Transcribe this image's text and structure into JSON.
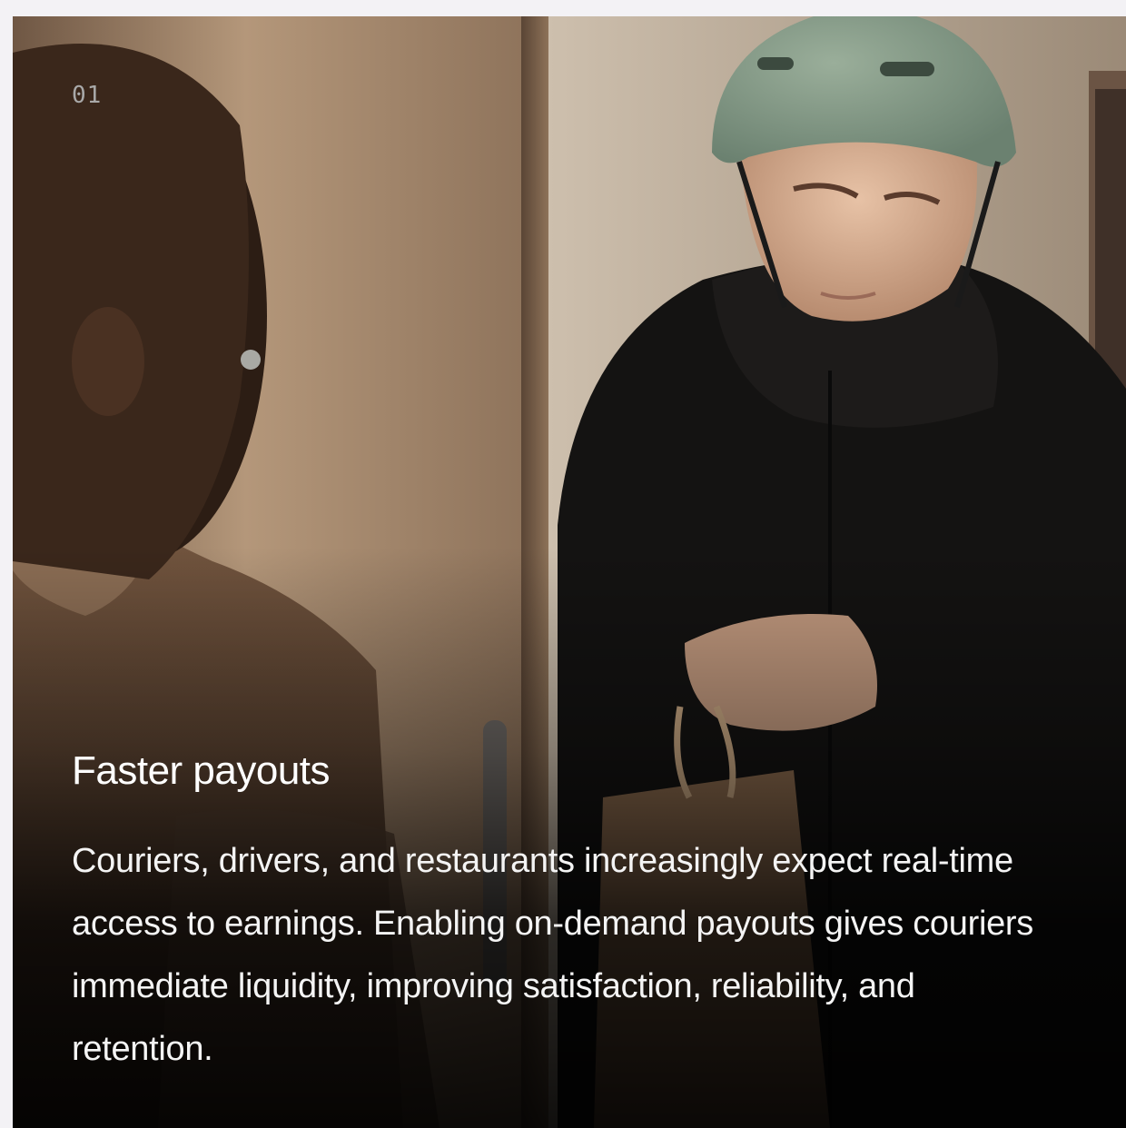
{
  "card": {
    "index": "01",
    "title": "Faster payouts",
    "description": "Couriers, drivers, and restaurants increasingly expect real-time access to earnings. Enabling on-demand payouts gives couriers immediate liquidity, improving satisfaction, reliability, and retention.",
    "photo_subject": "courier-handing-delivery-bag"
  },
  "colors": {
    "page_background": "#f3f2f5",
    "text_primary": "#ffffff",
    "index_text": "#a9a9a9",
    "helmet": "#7f9682",
    "jacket": "#141312",
    "door": "#a88a6c"
  }
}
